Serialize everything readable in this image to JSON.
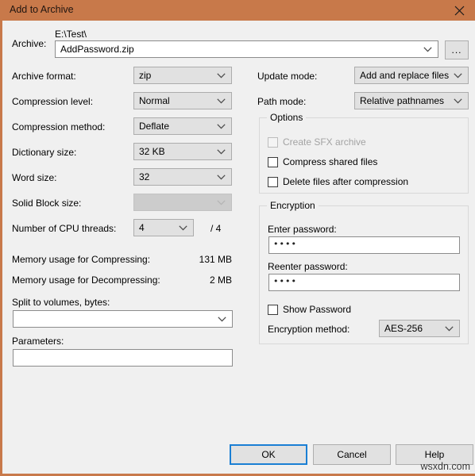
{
  "window": {
    "title": "Add to Archive",
    "close_icon": "close-icon",
    "titlebar_color": "#c8794a",
    "background_color": "#f0f0f0"
  },
  "archive": {
    "label": "Archive:",
    "path_text": "E:\\Test\\",
    "filename_value": "AddPassword.zip",
    "browse_label": "..."
  },
  "left_column": {
    "archive_format": {
      "label": "Archive format:",
      "value": "zip"
    },
    "compression_level": {
      "label": "Compression level:",
      "value": "Normal"
    },
    "compression_method": {
      "label": "Compression method:",
      "value": "Deflate"
    },
    "dictionary_size": {
      "label": "Dictionary size:",
      "value": "32 KB"
    },
    "word_size": {
      "label": "Word size:",
      "value": "32"
    },
    "solid_block_size": {
      "label": "Solid Block size:",
      "value": ""
    },
    "cpu_threads": {
      "label": "Number of CPU threads:",
      "value": "4",
      "total": "/ 4"
    },
    "memory_compressing": {
      "label": "Memory usage for Compressing:",
      "value": "131 MB"
    },
    "memory_decompressing": {
      "label": "Memory usage for Decompressing:",
      "value": "2 MB"
    },
    "split_volumes": {
      "label": "Split to volumes, bytes:",
      "value": ""
    },
    "parameters": {
      "label": "Parameters:",
      "value": ""
    }
  },
  "right_column": {
    "update_mode": {
      "label": "Update mode:",
      "value": "Add and replace files"
    },
    "path_mode": {
      "label": "Path mode:",
      "value": "Relative pathnames"
    },
    "options": {
      "title": "Options",
      "items": [
        {
          "label": "Create SFX archive",
          "checked": false,
          "enabled": false
        },
        {
          "label": "Compress shared files",
          "checked": false,
          "enabled": true
        },
        {
          "label": "Delete files after compression",
          "checked": false,
          "enabled": true
        }
      ]
    },
    "encryption": {
      "title": "Encryption",
      "enter_password": {
        "label": "Enter password:",
        "value": "••••"
      },
      "reenter_password": {
        "label": "Reenter password:",
        "value": "••••"
      },
      "show_password": {
        "label": "Show Password",
        "checked": false
      },
      "encryption_method": {
        "label": "Encryption method:",
        "value": "AES-256"
      }
    }
  },
  "buttons": {
    "ok": "OK",
    "cancel": "Cancel",
    "help": "Help"
  },
  "watermark": "wsxdn.com"
}
